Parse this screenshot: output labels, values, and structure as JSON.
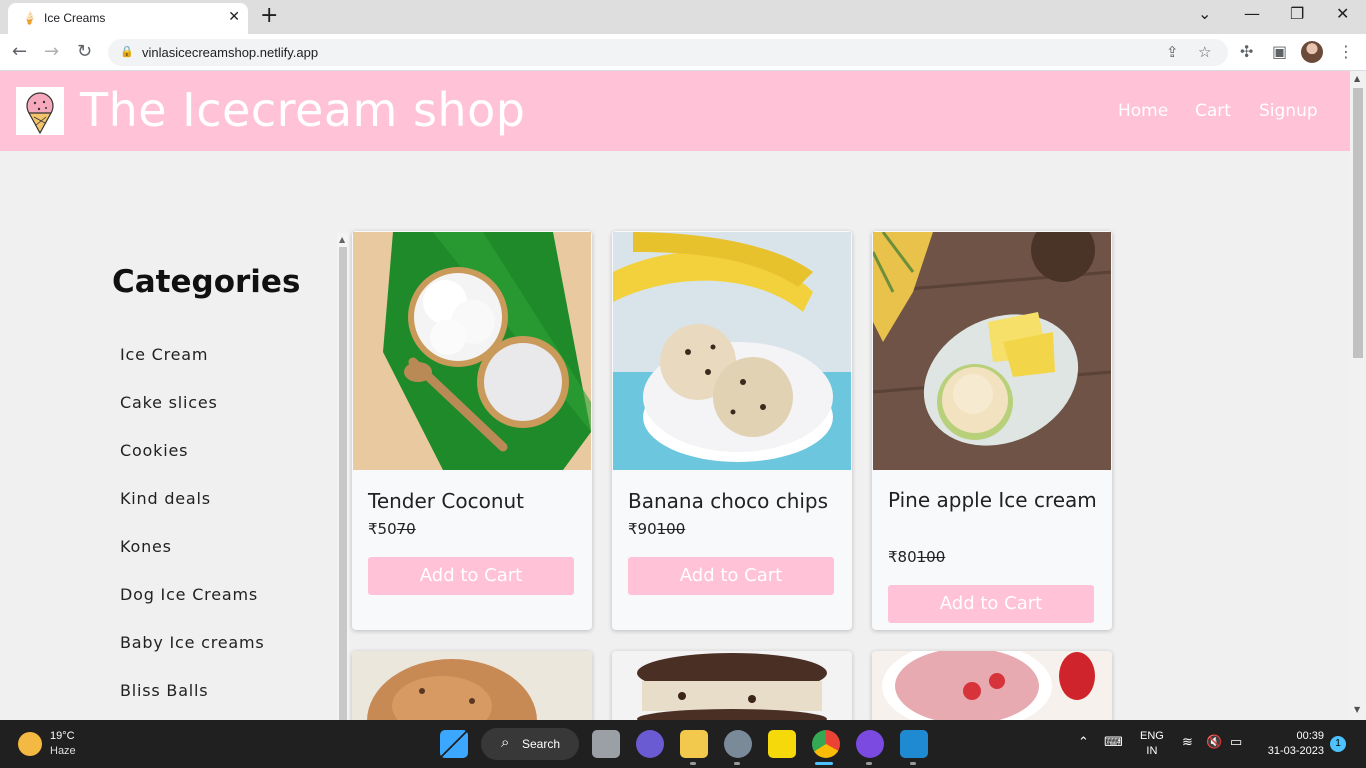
{
  "browser": {
    "tab_title": "Ice Creams",
    "tab_close": "✕",
    "new_tab": "+",
    "url": "vinlasicecreamshop.netlify.app"
  },
  "site": {
    "brand": "The Icecream shop",
    "nav": [
      "Home",
      "Cart",
      "Signup"
    ],
    "accent_color": "#ffc2d6"
  },
  "sidebar": {
    "title": "Categories",
    "items": [
      "Ice Cream",
      "Cake slices",
      "Cookies",
      "Kind deals",
      "Kones",
      "Dog Ice Creams",
      "Baby Ice creams",
      "Bliss Balls"
    ]
  },
  "products": [
    {
      "name": "Tender Coconut",
      "currency": "₹",
      "price": "50",
      "old_price": "70",
      "button": "Add to Cart"
    },
    {
      "name": "Banana choco chips",
      "currency": "₹",
      "price": "90",
      "old_price": "100",
      "button": "Add to Cart"
    },
    {
      "name": "Pine apple Ice cream",
      "currency": "₹",
      "price": "80",
      "old_price": "100",
      "button": "Add to Cart"
    }
  ],
  "taskbar": {
    "temperature": "19°C",
    "weather": "Haze",
    "search_label": "Search",
    "lang_1": "ENG",
    "lang_2": "IN",
    "time": "00:39",
    "date": "31-03-2023",
    "notification_count": "1"
  }
}
